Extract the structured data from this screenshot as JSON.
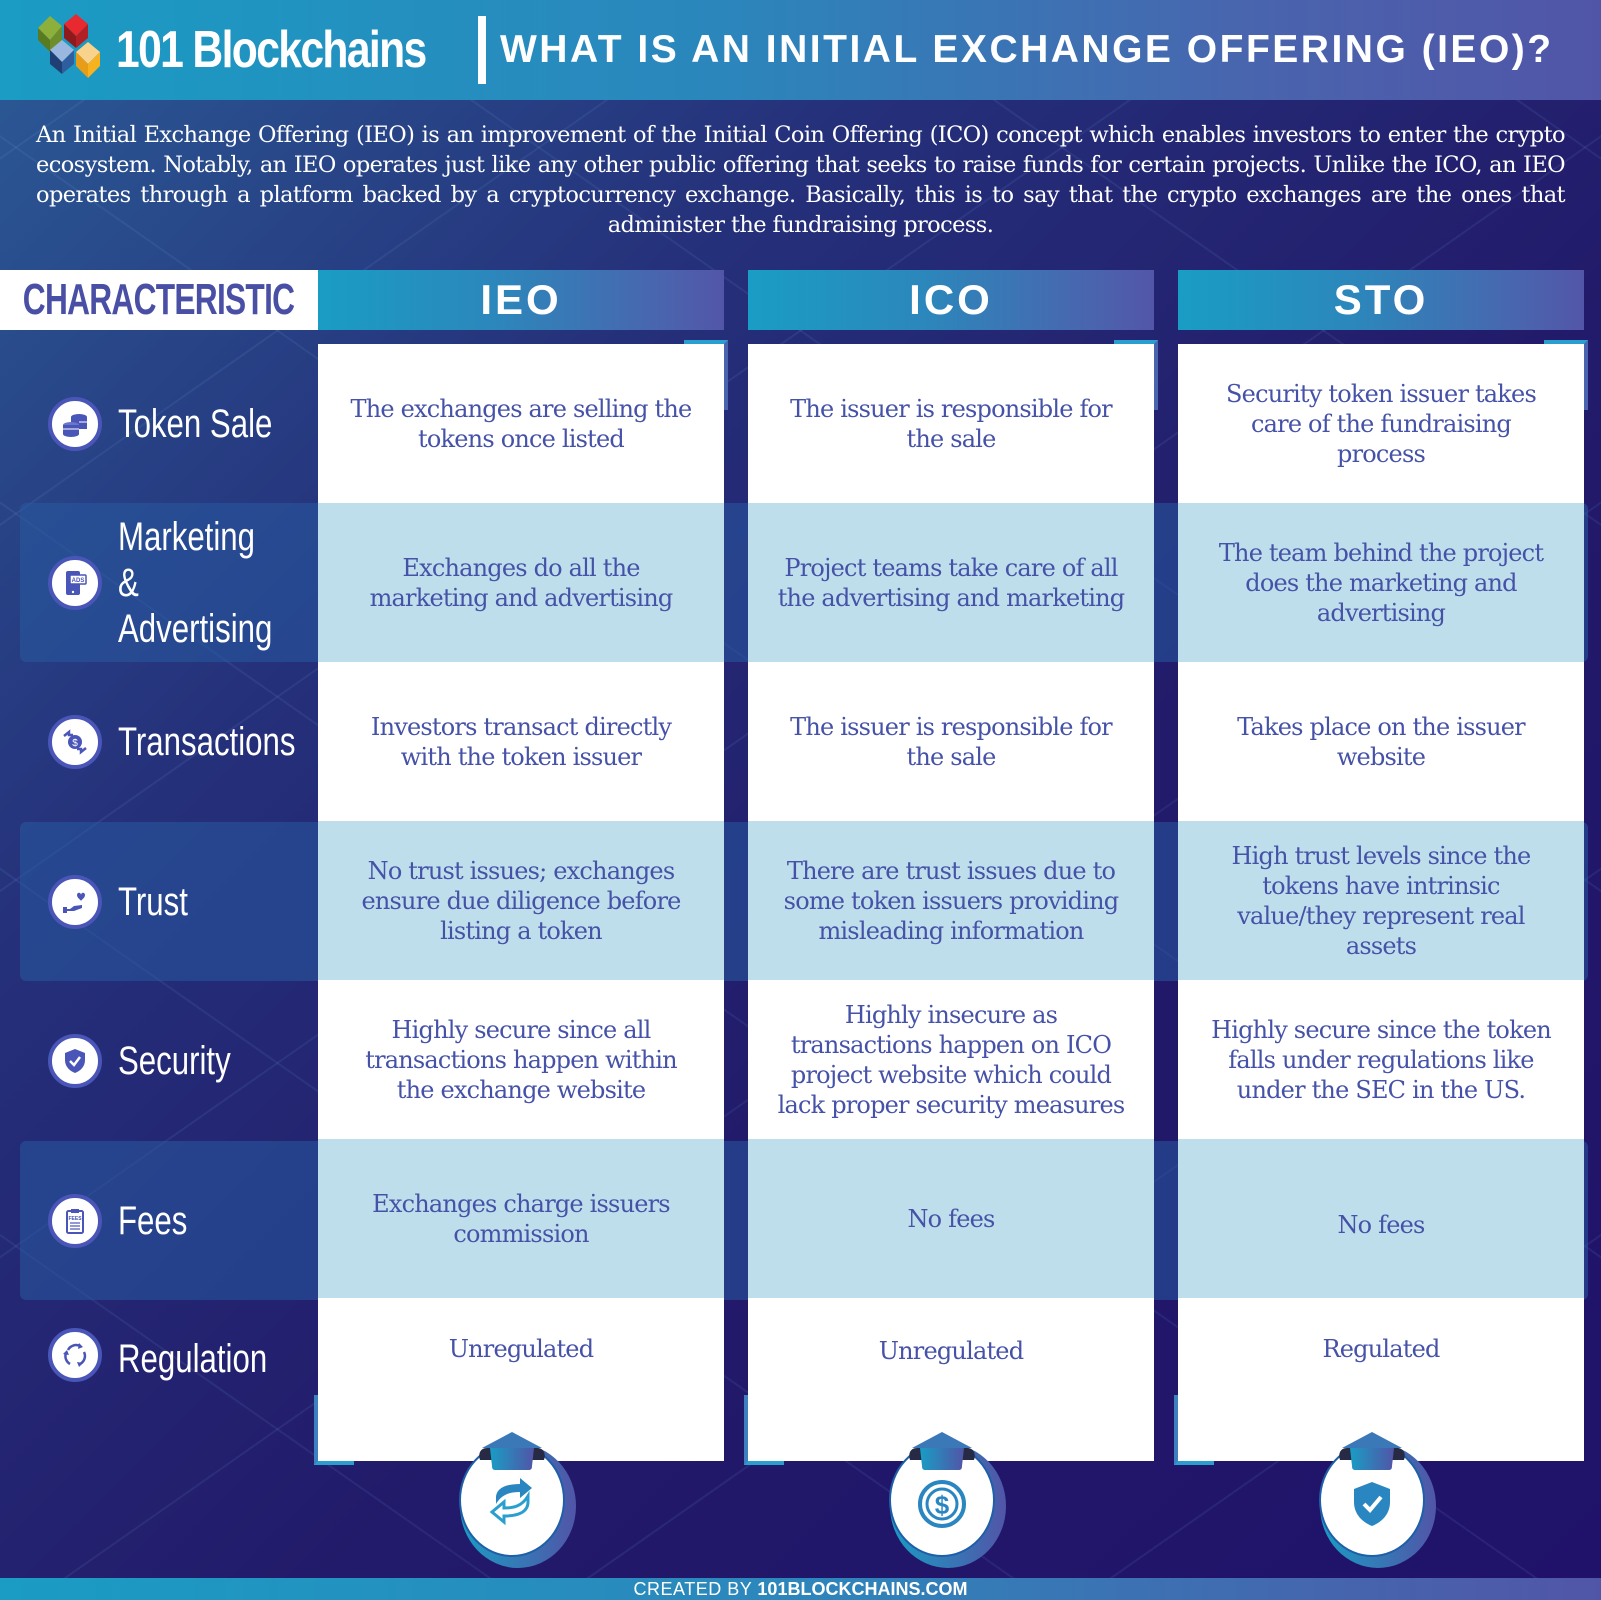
{
  "header": {
    "brand": "101 Blockchains",
    "title": "WHAT IS AN INITIAL EXCHANGE OFFERING (IEO)?"
  },
  "intro": "An Initial Exchange Offering (IEO) is an improvement of the Initial Coin Offering (ICO) concept which enables investors to enter the crypto ecosystem. Notably, an IEO operates just like any other public offering that seeks to raise funds for certain projects. Unlike the ICO, an IEO operates through a platform backed by a cryptocurrency exchange. Basically, this is to say that the crypto exchanges are the ones that administer the fundraising process.",
  "table": {
    "characteristic_header": "CHARACTERISTIC",
    "columns": [
      "IEO",
      "ICO",
      "STO"
    ],
    "rows": [
      {
        "label": "Token Sale",
        "icon": "coins-icon",
        "cells": [
          "The exchanges are selling the tokens once listed",
          "The issuer is responsible for the sale",
          "Security token issuer takes care of the fundraising process"
        ]
      },
      {
        "label": "Marketing & Advertising",
        "icon": "ads-phone-icon",
        "cells": [
          "Exchanges do all the marketing and advertising",
          "Project teams take care of all the advertising and marketing",
          "The team behind the project does the marketing and advertising"
        ]
      },
      {
        "label": "Transactions",
        "icon": "money-exchange-icon",
        "cells": [
          "Investors transact directly with the token issuer",
          "The issuer is responsible for the sale",
          "Takes place on the issuer website"
        ]
      },
      {
        "label": "Trust",
        "icon": "hand-heart-icon",
        "cells": [
          "No trust issues; exchanges ensure due diligence before listing a token",
          "There are trust issues due to some token issuers providing misleading information",
          "High trust levels since the tokens have intrinsic value/they represent real assets"
        ]
      },
      {
        "label": "Security",
        "icon": "shield-check-icon",
        "cells": [
          "Highly secure since all transactions happen within the exchange website",
          "Highly insecure as transactions happen on ICO project website which could lack proper security measures",
          "Highly secure since the token falls under regulations like under the SEC in the US."
        ]
      },
      {
        "label": "Fees",
        "icon": "fees-clipboard-icon",
        "cells": [
          "Exchanges charge issuers commission",
          "No fees",
          "No fees"
        ]
      },
      {
        "label": "Regulation",
        "icon": "cycle-arrows-icon",
        "cells": [
          "Unregulated",
          "Unregulated",
          "Regulated"
        ]
      }
    ],
    "badges": [
      "exchange-arrows-icon",
      "dollar-coin-icon",
      "shield-check-icon"
    ]
  },
  "footer": {
    "prefix": "CREATED BY ",
    "site": "101BLOCKCHAINS.COM"
  },
  "colors": {
    "accent_cyan": "#1a9cc4",
    "accent_purple": "#5155a8",
    "text_blue": "#4552a8",
    "shaded_cell": "#bddeea",
    "background_dark": "#20126a"
  }
}
